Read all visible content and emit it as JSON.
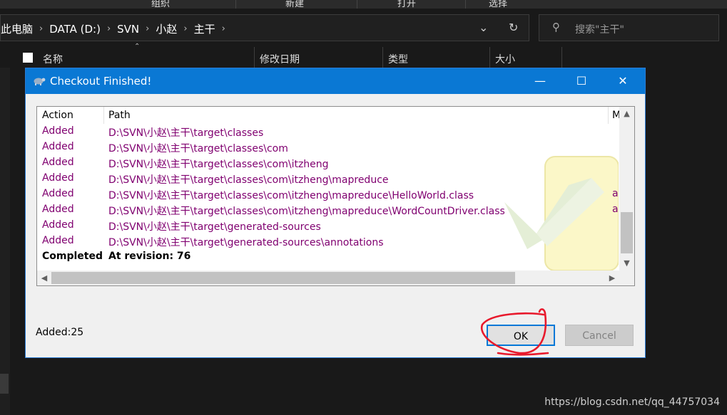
{
  "ribbon": {
    "items": [
      "组织",
      "新建",
      "打开",
      "选择"
    ]
  },
  "address_bar": {
    "breadcrumbs": [
      "此电脑",
      "DATA (D:)",
      "SVN",
      "小赵",
      "主干"
    ],
    "search_placeholder": "搜索\"主干\""
  },
  "columns": [
    "名称",
    "修改日期",
    "类型",
    "大小"
  ],
  "dialog": {
    "title": "Checkout Finished!",
    "list": {
      "headers": {
        "action": "Action",
        "path": "Path",
        "extra": "M"
      },
      "rows": [
        {
          "action": "Added",
          "path": "D:\\SVN\\小赵\\主干\\target\\classes",
          "extra": ""
        },
        {
          "action": "Added",
          "path": "D:\\SVN\\小赵\\主干\\target\\classes\\com",
          "extra": ""
        },
        {
          "action": "Added",
          "path": "D:\\SVN\\小赵\\主干\\target\\classes\\com\\itzheng",
          "extra": ""
        },
        {
          "action": "Added",
          "path": "D:\\SVN\\小赵\\主干\\target\\classes\\com\\itzheng\\mapreduce",
          "extra": ""
        },
        {
          "action": "Added",
          "path": "D:\\SVN\\小赵\\主干\\target\\classes\\com\\itzheng\\mapreduce\\HelloWorld.class",
          "extra": "a"
        },
        {
          "action": "Added",
          "path": "D:\\SVN\\小赵\\主干\\target\\classes\\com\\itzheng\\mapreduce\\WordCountDriver.class",
          "extra": "a"
        },
        {
          "action": "Added",
          "path": "D:\\SVN\\小赵\\主干\\target\\generated-sources",
          "extra": ""
        },
        {
          "action": "Added",
          "path": "D:\\SVN\\小赵\\主干\\target\\generated-sources\\annotations",
          "extra": ""
        }
      ],
      "completed": {
        "action": "Completed",
        "path": "At revision: 76"
      }
    },
    "summary": "Added:25",
    "ok_label": "OK",
    "cancel_label": "Cancel"
  },
  "watermark": "https://blog.csdn.net/qq_44757034",
  "colors": {
    "titlebar": "#0a78d4",
    "added_text": "#800070",
    "annotation": "#e8192c"
  }
}
